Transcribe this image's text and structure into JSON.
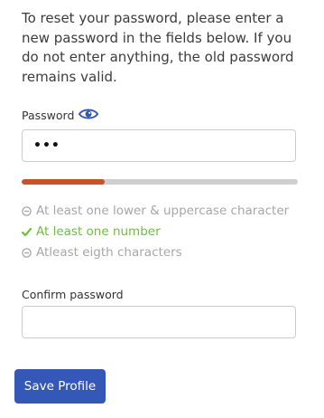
{
  "intro_text": "To reset your password, please enter a new password in the fields below. If you do not enter anything, the old password remains valid.",
  "password": {
    "label": "Password",
    "value": "•••",
    "visibility_icon": "eye-icon"
  },
  "strength": {
    "fraction": 0.3,
    "color": "#c9522a",
    "track_color": "#cfcfcf"
  },
  "rules": [
    {
      "text": "At least one lower & uppercase character",
      "status": "unmet",
      "icon": "minus-circle-icon"
    },
    {
      "text": "At least one number",
      "status": "met",
      "icon": "check-icon"
    },
    {
      "text": "Atleast eigth characters",
      "status": "unmet",
      "icon": "minus-circle-icon"
    }
  ],
  "confirm": {
    "label": "Confirm password",
    "value": ""
  },
  "save_button": {
    "label": "Save Profile",
    "color": "#3558b8"
  }
}
